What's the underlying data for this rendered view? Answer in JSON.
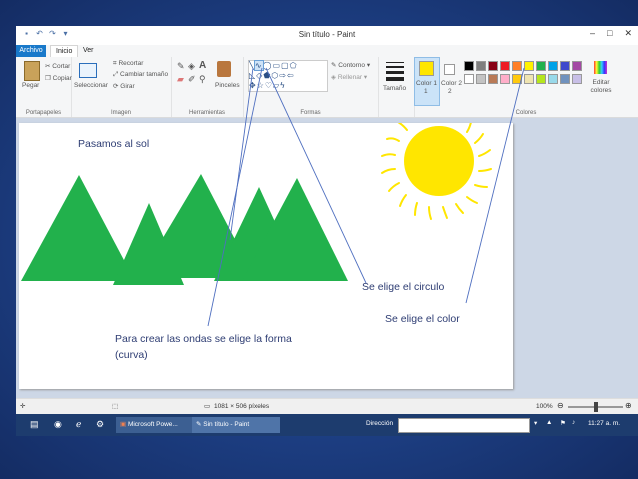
{
  "window": {
    "title": "Sin título - Paint",
    "controls": {
      "minimize": "–",
      "maximize": "□",
      "close": "✕"
    }
  },
  "tabs": {
    "file": "Archivo",
    "home": "Inicio",
    "view": "Ver"
  },
  "ribbon": {
    "clipboard": {
      "paste": "Pegar",
      "cut": "Cortar",
      "copy": "Copiar",
      "label": "Portapapeles"
    },
    "image": {
      "select": "Seleccionar",
      "crop": "Recortar",
      "resize": "Cambiar tamaño",
      "rotate": "Girar",
      "label": "Imagen"
    },
    "tools": {
      "brushes": "Pinceles",
      "label": "Herramientas"
    },
    "shapes": {
      "outline": "Contorno",
      "fill": "Rellenar",
      "label": "Formas"
    },
    "size": {
      "label": "Tamaño"
    },
    "colors": {
      "color1": "Color 1",
      "color2": "Color 2",
      "edit": "Editar colores",
      "label": "Colores",
      "accent": "#1979ca",
      "color1_value": "#ffe600",
      "color2_value": "#ffffff",
      "palette_row1": [
        "#000000",
        "#7f7f7f",
        "#880015",
        "#ed1c24",
        "#ff7f27",
        "#fff200",
        "#22b14c",
        "#00a2e8",
        "#3f48cc",
        "#a349a4"
      ],
      "palette_row2": [
        "#ffffff",
        "#c3c3c3",
        "#b97a57",
        "#ffaec9",
        "#ffc90e",
        "#efe4b0",
        "#b5e61d",
        "#99d9ea",
        "#7092be",
        "#c8bfe7"
      ]
    }
  },
  "drawing": {
    "text": "Pasamos al sol",
    "sun_color": "#ffe600",
    "tree_color": "#22b14c"
  },
  "annotations": {
    "circle": "Se elige el circulo",
    "color": "Se  elige el color",
    "curve_line1": "Para crear las ondas se elige la forma",
    "curve_line2": "(curva)"
  },
  "statusbar": {
    "dimensions": "1081 × 506 píxeles",
    "zoom": "100%"
  },
  "taskbar": {
    "powerpoint": "Microsoft Powe...",
    "paint": "Sin título - Paint",
    "address_label": "Dirección",
    "time": "11:27 a. m."
  }
}
